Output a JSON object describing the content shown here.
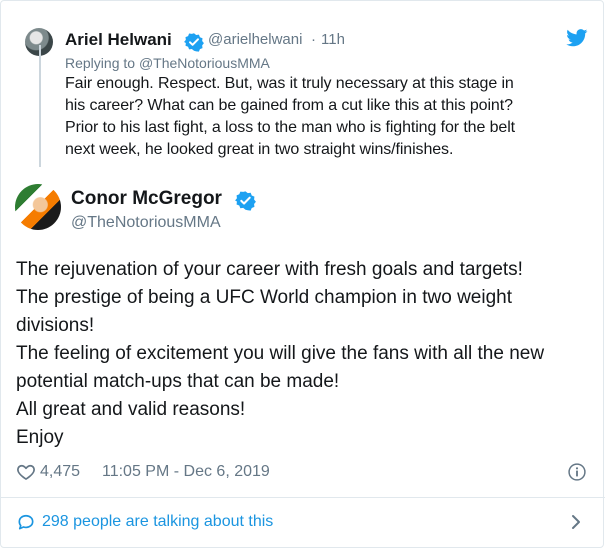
{
  "parent_tweet": {
    "author_name": "Ariel Helwani",
    "author_handle": "@arielhelwani",
    "separator": "·",
    "time_ago": "11h",
    "replying_to_prefix": "Replying to ",
    "replying_to_handle": "@TheNotoriousMMA",
    "text_lines": [
      "Fair enough. Respect. But, was it truly necessary at this stage in",
      "his career? What can be gained from a cut like this at this point?",
      "Prior to his last fight, a loss to the man who is fighting for the belt",
      "next week, he looked great in two straight wins/finishes."
    ]
  },
  "main_tweet": {
    "author_name": "Conor McGregor",
    "author_handle": "@TheNotoriousMMA",
    "text_lines": [
      "The rejuvenation of your career with fresh goals and targets!",
      "The prestige of being a UFC World champion in two weight",
      "divisions!",
      "The feeling of excitement you will give the fans with all the new",
      "potential match-ups that can be made!",
      "All great and valid reasons!",
      "Enjoy"
    ],
    "like_count": "4,475",
    "timestamp": "11:05 PM - Dec 6, 2019"
  },
  "footer": {
    "talking_label": "298 people are talking about this"
  },
  "icons": {
    "verified": "verified-badge-icon",
    "twitter": "twitter-bird-icon",
    "heart": "heart-icon",
    "info": "info-icon",
    "talk": "speech-bubble-icon",
    "chevron": "chevron-right-icon"
  },
  "colors": {
    "brand_blue": "#1da1f2",
    "link_blue": "#1b95e0",
    "secondary_text": "#657786",
    "primary_text": "#14171a",
    "border": "#e1e8ed"
  }
}
